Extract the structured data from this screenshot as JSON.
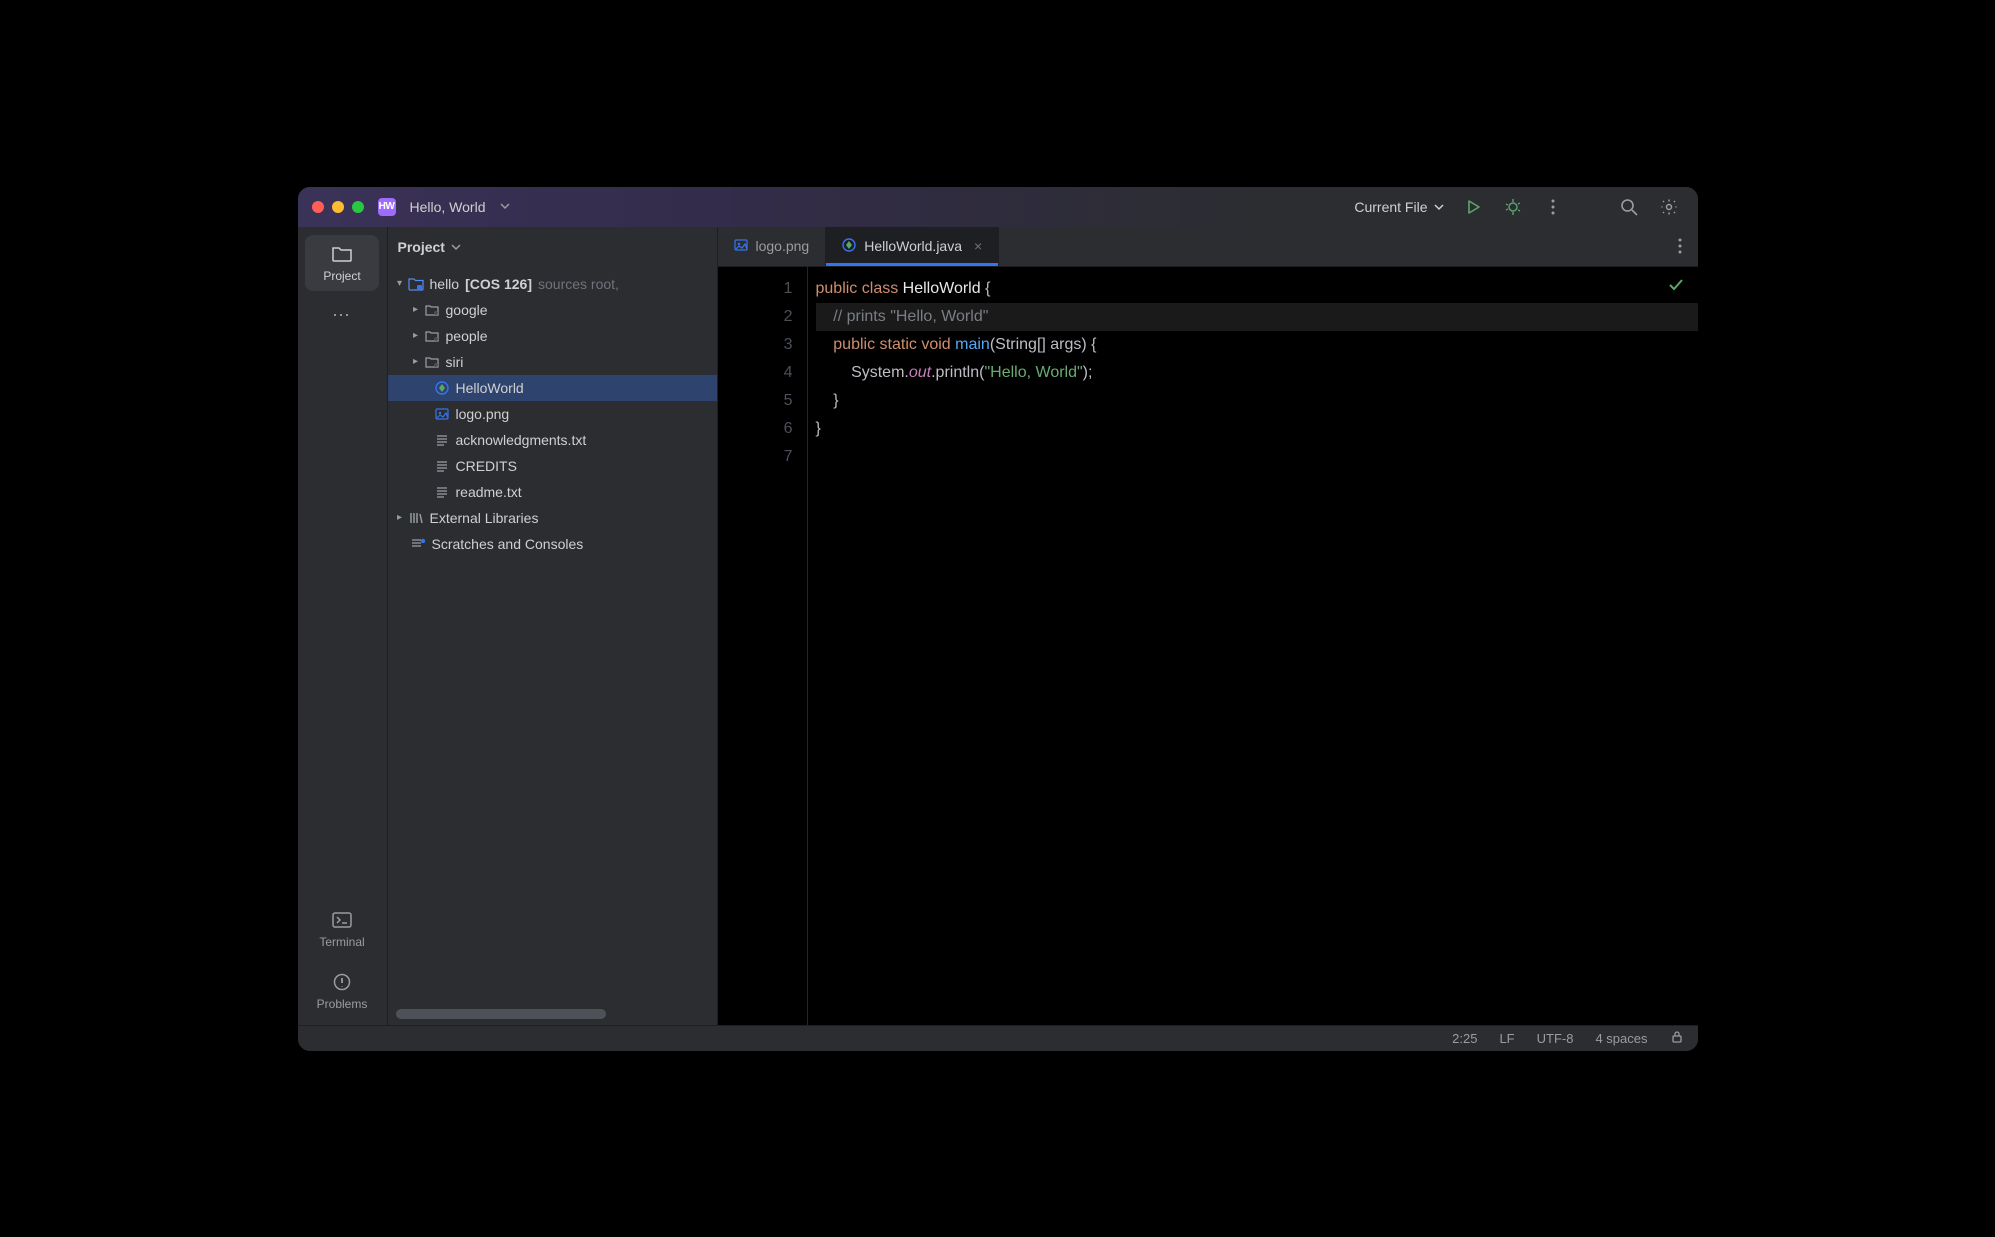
{
  "title": {
    "app_initials": "HW",
    "project_name": "Hello, World"
  },
  "toolbar": {
    "run_config": "Current File"
  },
  "left_tools": {
    "project": "Project",
    "terminal": "Terminal",
    "problems": "Problems"
  },
  "project_panel": {
    "title": "Project",
    "root": {
      "name": "hello",
      "qualifier": "[COS 126]",
      "annotation": "sources root,"
    },
    "folders": [
      "google",
      "people",
      "siri"
    ],
    "files": {
      "helloworld": "HelloWorld",
      "logo": "logo.png",
      "ack": "acknowledgments.txt",
      "credits": "CREDITS",
      "readme": "readme.txt"
    },
    "external": "External Libraries",
    "scratches": "Scratches and Consoles"
  },
  "tabs": {
    "logo": "logo.png",
    "hello": "HelloWorld.java"
  },
  "code": {
    "l1_kw1": "public",
    "l1_kw2": "class",
    "l1_cls": "HelloWorld",
    "l1_brace": " {",
    "l2": "    // prints \"Hello, World\"",
    "l3_kw": "    public static void ",
    "l3_mth": "main",
    "l3_p1": "(",
    "l3_typ": "String",
    "l3_ar": "[] ",
    "l3_arg": "args",
    "l3_p2": ") {",
    "l4_a": "        System.",
    "l4_out": "out",
    "l4_b": ".println(",
    "l4_str": "\"Hello, World\"",
    "l4_c": ");",
    "l5": "    }",
    "l6": "}"
  },
  "linenos": [
    "1",
    "2",
    "3",
    "4",
    "5",
    "6",
    "7"
  ],
  "status": {
    "cursor": "2:25",
    "lf": "LF",
    "enc": "UTF-8",
    "indent": "4 spaces"
  }
}
